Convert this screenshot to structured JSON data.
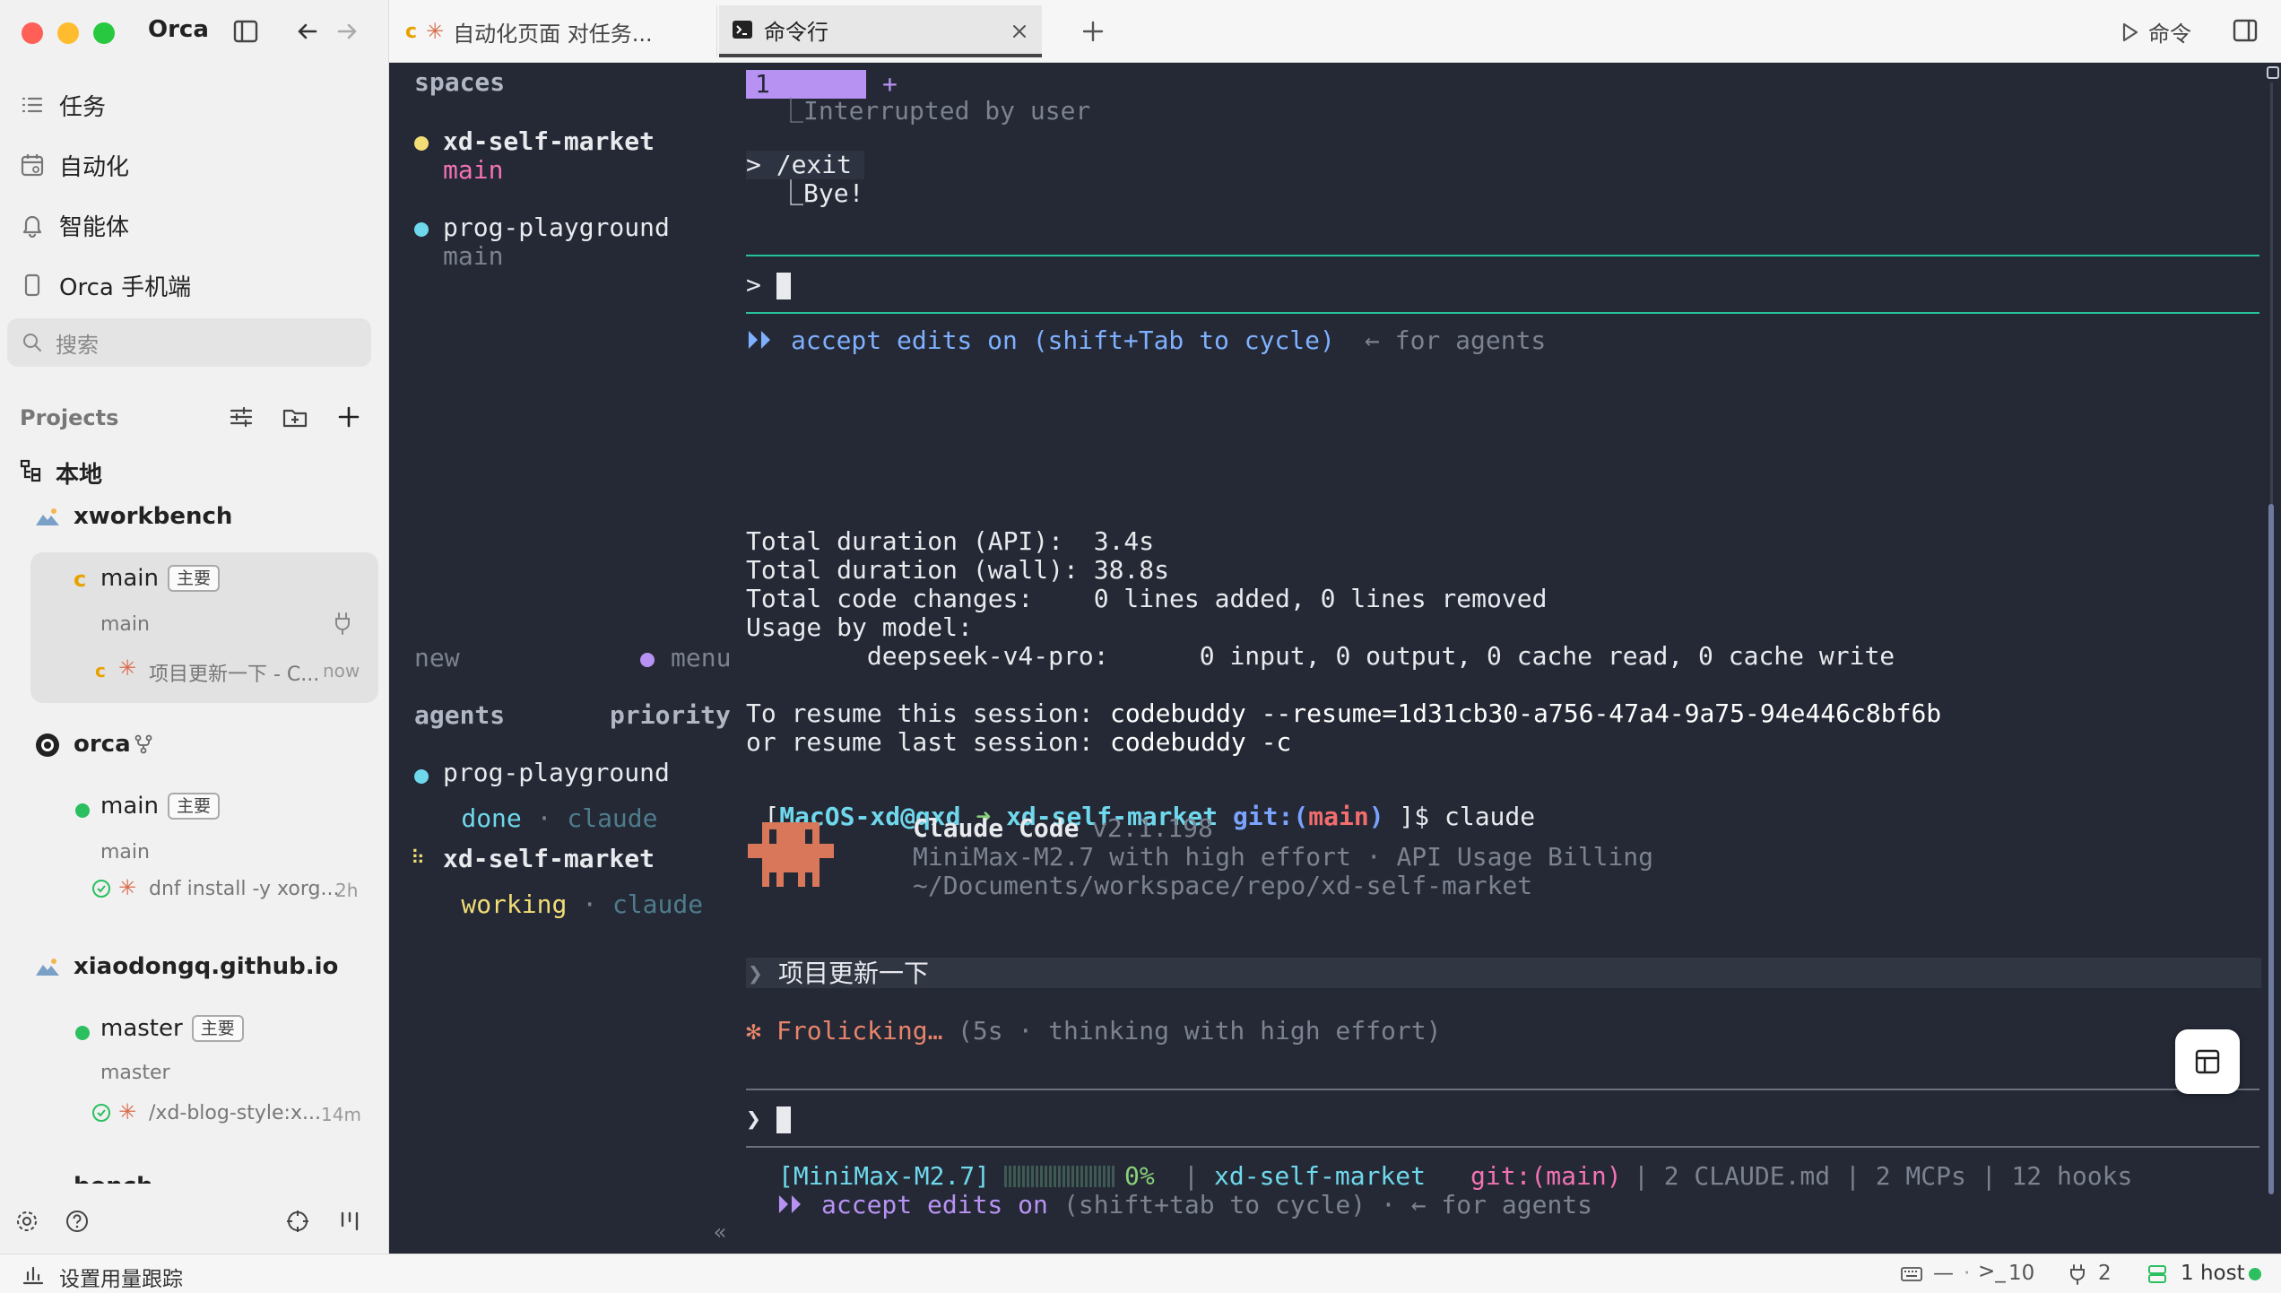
{
  "app": {
    "name": "Orca"
  },
  "sidebar": {
    "nav": [
      {
        "label": "任务",
        "icon": "list-icon"
      },
      {
        "label": "自动化",
        "icon": "calendar-icon"
      },
      {
        "label": "智能体",
        "icon": "bell-icon"
      },
      {
        "label": "Orca 手机端",
        "icon": "phone-icon"
      }
    ],
    "search_placeholder": "搜索",
    "projects_label": "Projects",
    "local_label": "本地",
    "projects": [
      {
        "name": "xworkbench",
        "branch": "main",
        "badge": "主要",
        "sub_branch": "main",
        "task": "项目更新一下 - C...",
        "task_time": "now"
      },
      {
        "name": "orca",
        "branch": "main",
        "badge": "主要",
        "sub_branch": "main",
        "task": "dnf install -y xorg...",
        "task_time": "2h"
      },
      {
        "name": "xiaodongq.github.io",
        "branch": "master",
        "badge": "主要",
        "sub_branch": "master",
        "task": "/xd-blog-style:x...",
        "task_time": "14m"
      }
    ],
    "partial_project": "bench"
  },
  "tabs": [
    {
      "label": "自动化页面 对任务...",
      "active": false
    },
    {
      "label": "命令行",
      "active": true
    }
  ],
  "toolbar": {
    "command_label": "命令"
  },
  "tmux": {
    "spaces_header": "spaces",
    "spaces": [
      {
        "name": "xd-self-market",
        "branch": "main",
        "color": "#f2dd76"
      },
      {
        "name": "prog-playground",
        "branch": "main",
        "color": "#6fd8ec"
      }
    ],
    "new_label": "new",
    "menu_label": "menu",
    "agents_header": "agents",
    "priority_header": "priority",
    "agents": [
      {
        "name": "prog-playground",
        "status": "done",
        "sep": "·",
        "agent": "claude"
      },
      {
        "name": "xd-self-market",
        "status": "working",
        "sep": "·",
        "agent": "claude"
      }
    ],
    "collapse": "«"
  },
  "terminal": {
    "tab_num": "1",
    "tab_plus": "+",
    "interrupted": "⎿Interrupted by user",
    "exit_cmd": "> /exit",
    "bye": "⎿Bye!",
    "prompt1": ">",
    "accept1_icon": "⏵⏵",
    "accept1": "accept edits on (shift+Tab to cycle)",
    "accept1_tail": "← for agents",
    "stats": [
      "Total duration (API):  3.4s",
      "Total duration (wall): 38.8s",
      "Total code changes:    0 lines added, 0 lines removed",
      "Usage by model:",
      "        deepseek-v4-pro:      0 input, 0 output, 0 cache read, 0 cache write"
    ],
    "resume1_label": "To resume this session:",
    "resume1_cmd": "codebuddy --resume=1d31cb30-a756-47a4-9a75-94e446c8bf6b",
    "resume2_label": "or resume last session:",
    "resume2_cmd": "codebuddy -c",
    "shell_open": "[",
    "shell_user": "MacOS-xd@qxd",
    "shell_arrow": "➜",
    "shell_dir": "xd-self-market",
    "shell_git": "git:(",
    "shell_branch": "main",
    "shell_git_close": ")",
    "shell_close": "]$ claude",
    "cc_title": "Claude Code",
    "cc_version": "v2.1.198",
    "cc_model": "MiniMax-M2.7 with high effort · API Usage Billing",
    "cc_path": "~/Documents/workspace/repo/xd-self-market",
    "user_msg_prefix": "❯",
    "user_msg": "项目更新一下",
    "spinner": "✻",
    "frolicking": "Frolicking…",
    "frolicking_detail": "(5s · thinking with high effort)",
    "prompt2": "❯",
    "status_model": "[MiniMax-M2.7]",
    "status_pct": "0%",
    "status_sep": "|",
    "status_dir": "xd-self-market",
    "status_git": "git:(main)",
    "status_rest": "| 2 CLAUDE.md | 2 MCPs | 12 hooks",
    "accept2_icon": "⏵⏵",
    "accept2": "accept edits on",
    "accept2_tail": "(shift+tab to cycle) · ← for agents"
  },
  "statusbar": {
    "usage_label": "设置用量跟踪",
    "dash": "—",
    "terminals": "10",
    "ports": "2",
    "hosts": "1 host"
  },
  "colors": {
    "terminal_bg": "#242935",
    "accent_green": "#27c19a",
    "spaces_yellow": "#f2dd76",
    "cyan": "#6fd8ec",
    "pink": "#f272b3",
    "purple": "#b892f3"
  }
}
